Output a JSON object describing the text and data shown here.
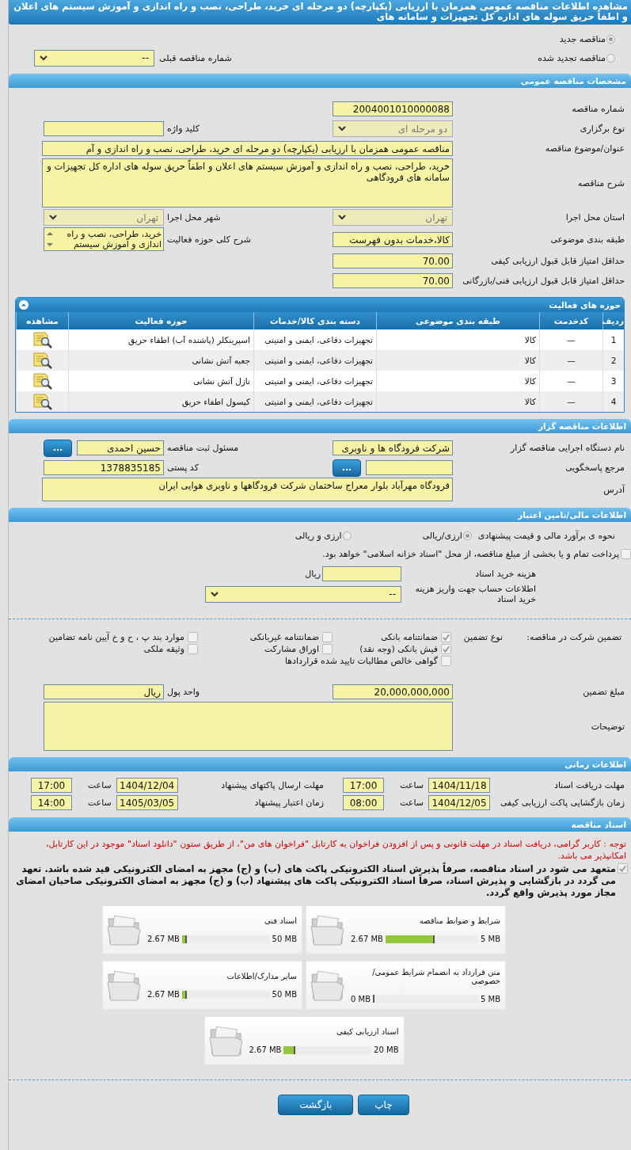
{
  "title": "مشاهده اطلاعات مناقصه عمومی همزمان با ارزیابی (یکپارچه) دو مرحله ای خرید، طراحی، نصب و راه اندازی و آموزش سیستم های اعلان و اطفاً حریق سوله های اداره کل تجهیزات و سامانه های",
  "tender_kind": [
    {
      "label": "مناقصه جدید",
      "selected": true
    },
    {
      "label": "مناقصه تجدید شده",
      "selected": false
    }
  ],
  "previous_tender": {
    "label": "شماره مناقصه قبلی",
    "value": "--"
  },
  "general": {
    "header": "مشخصات مناقصه عمومی",
    "rows": [
      {
        "fields": [
          {
            "label": "شماره مناقصه",
            "kind": "input",
            "value": "2004001010000088"
          }
        ]
      },
      {
        "fields": [
          {
            "label": "نوع برگزاری",
            "kind": "select",
            "value": "دو مرحله ای",
            "disabled": true
          },
          {
            "label": "کلید واژه",
            "kind": "input"
          }
        ]
      },
      {
        "fields": [
          {
            "label": "عنوان/موضوع مناقصه",
            "kind": "wide_input",
            "value": "مناقصه عمومی همزمان با ارزیابی (یکپارچه) دو مرحله ای خرید، طراحی، نصب و راه اندازی و آم"
          }
        ]
      },
      {
        "fields": [
          {
            "label": "شرح مناقصه",
            "kind": "textarea",
            "value": "خرید، طراحی، نصب و راه اندازی و آموزش سیستم های اعلان و اطفاً حریق سوله های اداره کل تجهیزات و سامانه های  فرودگاهی"
          }
        ]
      },
      {
        "fields": [
          {
            "label": "استان محل اجرا",
            "kind": "select",
            "value": "تهران",
            "disabled": true
          },
          {
            "label": "شهر محل اجرا",
            "kind": "select",
            "value": "تهران",
            "disabled": true
          }
        ]
      },
      {
        "fields": [
          {
            "label": "طبقه بندی موضوعی",
            "kind": "input",
            "value": "کالا،خدمات بدون فهرست"
          },
          {
            "label": "شرح کلی حوزه فعالیت",
            "kind": "listbox",
            "value": "خرید، طراحی، نصب و راه اندازی و آموزش سیستم"
          }
        ]
      },
      {
        "fields": [
          {
            "label": "حداقل امتیاز قابل قبول ارزیابی کیفی",
            "kind": "input",
            "value": "70.00"
          }
        ]
      },
      {
        "fields": [
          {
            "label": "حداقل امتیاز قابل قبول ارزیابی فنی/بازرگانی",
            "kind": "input",
            "value": "70.00"
          }
        ]
      }
    ],
    "activities": {
      "title": "حوزه های فعالیت",
      "columns": [
        "ردیف",
        "کدخدمت",
        "طبقه بندی موضوعی",
        "دسته بندی کالا/خدمات",
        "حوزه فعالیت",
        "مشاهده"
      ],
      "rows": [
        {
          "row": "1",
          "service_code": "—",
          "classification": "کالا",
          "category": "تجهیزات دفاعی، ایمنی و امنیتی",
          "activity": "اسپرینکلر (پاشنده آب) اطفاء حریق"
        },
        {
          "row": "2",
          "service_code": "—",
          "classification": "کالا",
          "category": "تجهیزات دفاعی، ایمنی و امنیتی",
          "activity": "جعبه آتش نشانی"
        },
        {
          "row": "3",
          "service_code": "—",
          "classification": "کالا",
          "category": "تجهیزات دفاعی، ایمنی و امنیتی",
          "activity": "نازل آتش نشانی"
        },
        {
          "row": "4",
          "service_code": "—",
          "classification": "کالا",
          "category": "تجهیزات دفاعی، ایمنی و امنیتی",
          "activity": "کپسول اطفاء حریق"
        }
      ]
    }
  },
  "organizer": {
    "header": "اطلاعات مناقصه گزار",
    "rows": [
      {
        "fields": [
          {
            "label": "نام دستگاه اجرایی مناقصه گزار",
            "kind": "input",
            "value": "شرکت فرودگاه ها و ناوبری"
          },
          {
            "label": "مسئول ثبت مناقصه",
            "kind": "input_button",
            "value": "حسین احمدی",
            "button": "..."
          }
        ]
      },
      {
        "fields": [
          {
            "label": "مرجع پاسخگویی",
            "kind": "input_button",
            "button": "..."
          },
          {
            "label": "کد پستی",
            "kind": "input",
            "value": "1378835185"
          }
        ]
      },
      {
        "fields": [
          {
            "label": "آدرس",
            "kind": "short_textarea",
            "value": "فرودگاه مهرآباد بلوار معراج ساختمان شرکت فرودگاهها و ناوبری هوایی ایران"
          }
        ]
      }
    ]
  },
  "financial": {
    "header": "اطلاعات مالی/تامین اعتبار",
    "estimate": {
      "label": "نحوه ی برآورد مالی و قیمت پیشنهادی",
      "options": [
        {
          "label": "ارزی/ریالی",
          "selected": true
        },
        {
          "label": "ارزی و ریالی",
          "selected": false
        }
      ]
    },
    "treasury": {
      "label": "پرداخت تمام و یا بخشی از مبلغ مناقصه، از محل \"اسناد خزانه اسلامی\" خواهد بود.",
      "checked": false
    },
    "doc_cost": {
      "label": "هزینه خرید اسناد",
      "unit": "ریال"
    },
    "account": {
      "label": "اطلاعات حساب جهت واریز هزینه خرید اسناد",
      "value": "--"
    }
  },
  "guarantee": {
    "title": "تضمین شرکت در مناقصه:",
    "type_label": "نوع تضمین",
    "options": [
      {
        "label": "ضمانتنامه بانکی",
        "checked": true
      },
      {
        "label": "ضمانتنامه غیربانکی",
        "checked": false
      },
      {
        "label": "موارد بند پ ، ح و خ آیین نامه تضامین",
        "checked": false
      },
      {
        "label": "فیش بانکی (وجه نقد)",
        "checked": true
      },
      {
        "label": "اوراق مشارکت",
        "checked": false
      },
      {
        "label": "وثیقه ملکی",
        "checked": false
      },
      {
        "label": "گواهی خالص مطالبات تایید شده قراردادها",
        "checked": false
      }
    ],
    "amount": {
      "label": "مبلغ تضمین",
      "value": "20,000,000,000"
    },
    "currency": {
      "label": "واحد پول",
      "value": "ریال"
    },
    "notes": {
      "label": "توضیحات"
    }
  },
  "timing": {
    "header": "اطلاعات زمانی",
    "rows": [
      [
        {
          "label": "مهلت دریافت اسناد",
          "date": "1404/11/18",
          "time_label": "ساعت",
          "time": "17:00"
        },
        {
          "label": "مهلت ارسال پاکتهای پیشنهاد",
          "date": "1404/12/04",
          "time_label": "ساعت",
          "time": "17:00"
        }
      ],
      [
        {
          "label": "زمان بازگشایی پاکت ارزیابی کیفی",
          "date": "1404/12/05",
          "time_label": "ساعت",
          "time": "08:00"
        },
        {
          "label": "زمان اعتبار پیشنهاد",
          "date": "1405/03/05",
          "time_label": "ساعت",
          "time": "14:00"
        }
      ]
    ]
  },
  "documents": {
    "header": "اسناد مناقصه",
    "notice": "توجه : کاربر گرامی، دریافت اسناد در مهلت قانونی و پس از افزودن فراخوان به کارتابل \"فراخوان های من\"، از طریق ستون \"دانلود اسناد\" موجود در این کارتابل، امکانپذیر می باشد.",
    "commitment": {
      "text": "متعهد می شود در اسناد مناقصه، صرفاً پذیرش اسناد الکترونیکی پاکت های (ب) و (ج) مجهز به امضای الکترونیکی قید شده باشد. تعهد می گردد در بازگشایی و پذیرش اسناد، صرفاً اسناد الکترونیکی پاکت های پیشنهاد (ب) و (ج) مجهز به امضای الکترونیکی صاحبان امضای مجاز مورد پذیرش واقع گردد.",
      "checked": true
    },
    "files": [
      {
        "name": "شرایط و ضوابط مناقصه",
        "used": "2.67 MB",
        "max": "5 MB",
        "level": 0.534
      },
      {
        "name": "اسناد فنی",
        "used": "2.67 MB",
        "max": "50 MB",
        "level": 0.053
      },
      {
        "name": "متن قرارداد به انضمام شرایط عمومی/خصوصی",
        "used": "0 MB",
        "max": "5 MB",
        "level": 0
      },
      {
        "name": "سایر مدارک/اطلاعات",
        "used": "2.67 MB",
        "max": "50 MB",
        "level": 0.053
      },
      {
        "name": "اسناد ارزیابی کیفی",
        "used": "2.67 MB",
        "max": "20 MB",
        "level": 0.134
      }
    ]
  },
  "buttons": [
    "چاپ",
    "بازگشت"
  ]
}
